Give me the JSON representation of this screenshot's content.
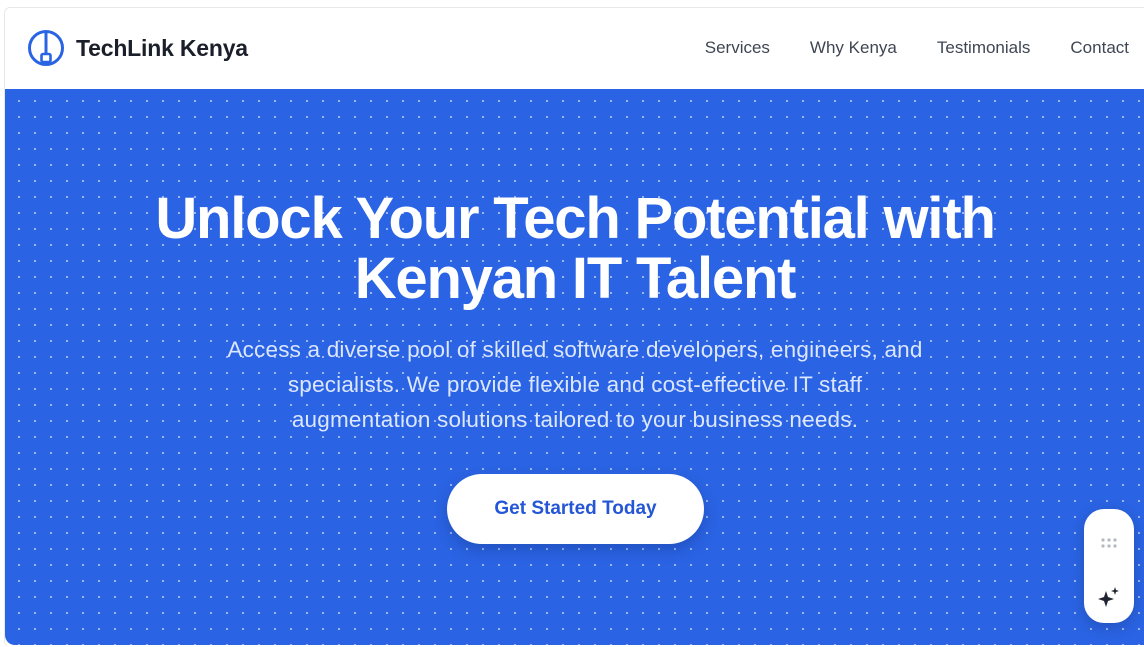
{
  "brand": {
    "name": "TechLink Kenya",
    "logo_icon": "plug-circle-icon"
  },
  "nav": {
    "items": [
      {
        "label": "Services"
      },
      {
        "label": "Why Kenya"
      },
      {
        "label": "Testimonials"
      },
      {
        "label": "Contact"
      }
    ]
  },
  "hero": {
    "title_line1": "Unlock Your Tech Potential with",
    "title_line2": "Kenyan IT Talent",
    "subtitle_line1": "Access a diverse pool of skilled software developers, engineers, and",
    "subtitle_line2": "specialists. We provide flexible and cost-effective IT staff",
    "subtitle_line3": "augmentation solutions tailored to your business needs.",
    "cta_label": "Get Started Today",
    "background_color": "#2a63e3",
    "pattern": "dot-grid"
  },
  "floating_widget": {
    "icons": [
      "drag-grip-icon",
      "sparkle-icon"
    ]
  },
  "colors": {
    "accent": "#2a63e3",
    "button_text": "#2456d6",
    "nav_text": "#3f4653",
    "brand_text": "#1b1f2a"
  }
}
